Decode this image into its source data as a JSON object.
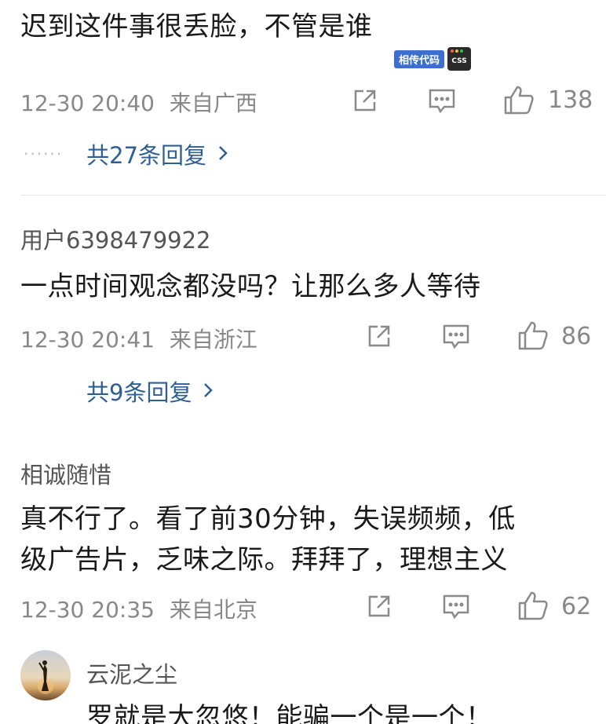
{
  "comments": [
    {
      "content": [
        "迟到这件事很丢脸，不管是谁"
      ],
      "timestamp": "12-30 20:40",
      "location": "来自广西",
      "likes": "138",
      "replies": "共27条回复",
      "badge": {
        "label": "相传代码",
        "icon_text": "CSS"
      }
    },
    {
      "username": "用户6398479922",
      "content": [
        "一点时间观念都没吗？让那么多人等待"
      ],
      "timestamp": "12-30 20:41",
      "location": "来自浙江",
      "likes": "86",
      "replies": "共9条回复"
    },
    {
      "username": "相诚随惜",
      "content": [
        "真不行了。看了前30分钟，失误频频，低",
        "级广告片，乏味之际。拜拜了，理想主义"
      ],
      "timestamp": "12-30 20:35",
      "location": "来自北京",
      "likes": "62"
    },
    {
      "username": "云泥之尘",
      "content": [
        "罗就是大忽悠！能骗一个是一个！"
      ]
    }
  ],
  "icons": {
    "share": "share-icon",
    "comment": "comment-icon",
    "like": "thumbs-up-icon",
    "more": "chevron-right-icon"
  },
  "colors": {
    "reply_link": "#2d5f94",
    "meta": "#888888",
    "badge": "#3d6fcf"
  }
}
